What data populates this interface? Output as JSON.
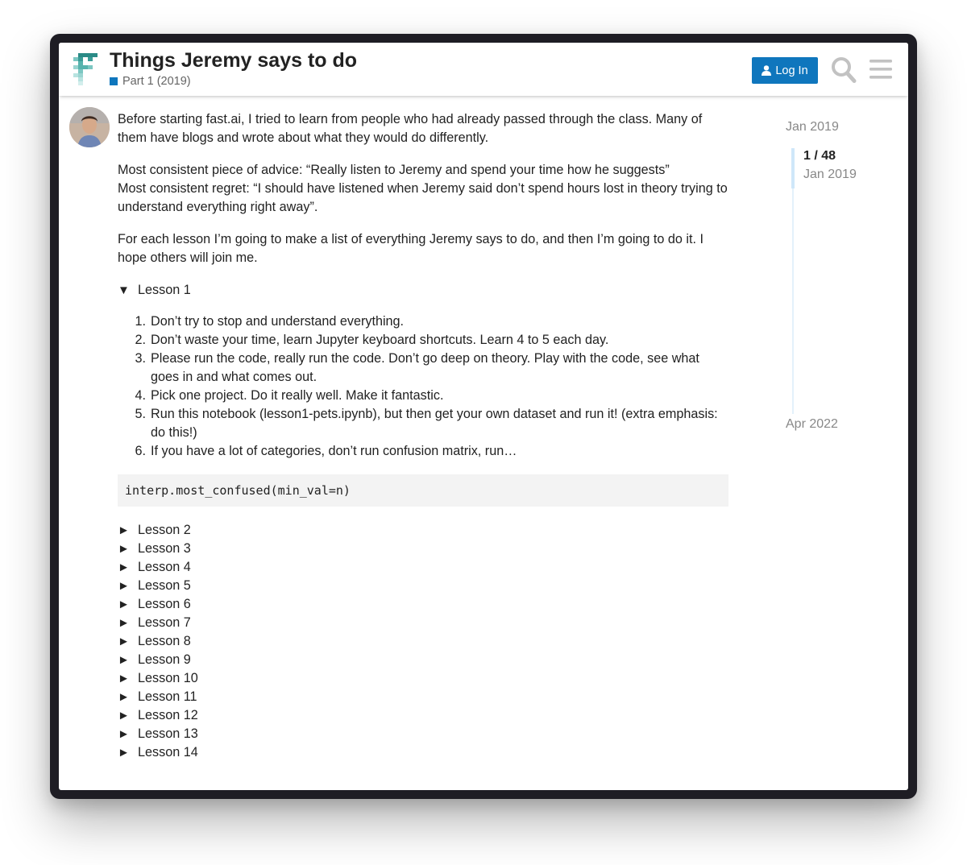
{
  "topic": {
    "title": "Things Jeremy says to do",
    "category": "Part 1 (2019)",
    "category_color": "#0e76bd"
  },
  "header": {
    "login_label": "Log In",
    "login_color": "#0f76bd"
  },
  "post": {
    "paragraphs": [
      "Before starting fast.ai, I tried to learn from people who had already passed through the class. Many of them have blogs and wrote about what they would do differently.",
      "Most consistent piece of advice: “Really listen to Jeremy and spend your time how he suggests”",
      "Most consistent regret: “I should have listened when Jeremy said don’t spend hours lost in theory trying to understand everything right away”.",
      "For each lesson I’m going to make a list of everything Jeremy says to do, and then I’m going to do it. I hope others will join me."
    ],
    "open_section": {
      "marker": "▼",
      "label": "Lesson 1",
      "items": [
        {
          "num": "1.",
          "text": "Don’t try to stop and understand everything."
        },
        {
          "num": "2.",
          "text": "Don’t waste your time, learn Jupyter keyboard shortcuts. Learn 4 to 5 each day."
        },
        {
          "num": "3.",
          "text": "Please run the code, really run the code. Don’t go deep on theory. Play with the code, see what goes in and what comes out."
        },
        {
          "num": "4.",
          "text": "Pick one project. Do it really well. Make it fantastic."
        },
        {
          "num": "5.",
          "text": "Run this notebook (lesson1-pets.ipynb), but then get your own dataset and run it! (extra emphasis: do this!)"
        },
        {
          "num": "6.",
          "text": "If you have a lot of categories, don’t run confusion matrix, run…"
        }
      ],
      "code": "interp.most_confused(min_val=n)"
    },
    "collapsed_marker": "►",
    "collapsed_sections": [
      "Lesson 2",
      "Lesson 3",
      "Lesson 4",
      "Lesson 5",
      "Lesson 6",
      "Lesson 7",
      "Lesson 8",
      "Lesson 9",
      "Lesson 10",
      "Lesson 11",
      "Lesson 12",
      "Lesson 13",
      "Lesson 14"
    ]
  },
  "timeline": {
    "start_date": "Jan 2019",
    "position": "1 / 48",
    "current_date": "Jan 2019",
    "end_date": "Apr 2022"
  },
  "icons": {
    "logo": "fastai-logo",
    "login": "user-icon",
    "search": "search-icon",
    "menu": "hamburger-menu-icon"
  }
}
